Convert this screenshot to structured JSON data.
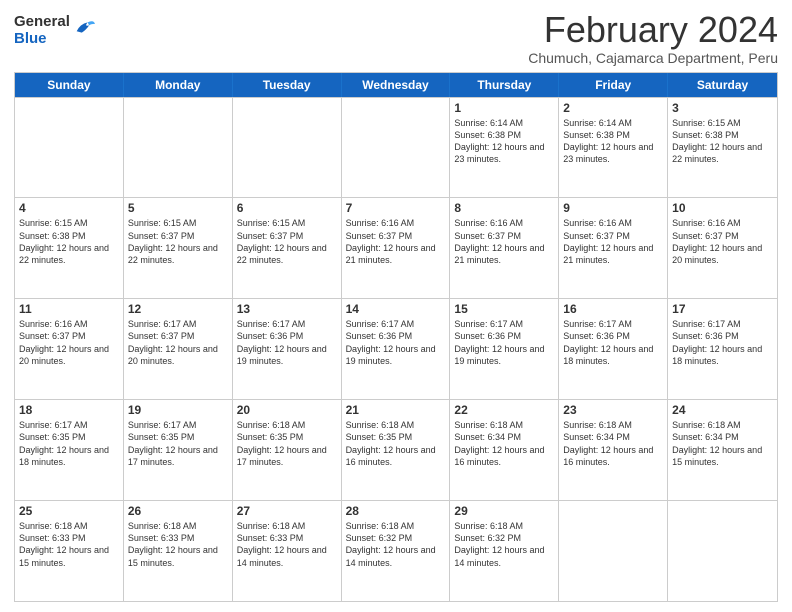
{
  "header": {
    "logo_general": "General",
    "logo_blue": "Blue",
    "cal_title": "February 2024",
    "cal_subtitle": "Chumuch, Cajamarca Department, Peru"
  },
  "days_of_week": [
    "Sunday",
    "Monday",
    "Tuesday",
    "Wednesday",
    "Thursday",
    "Friday",
    "Saturday"
  ],
  "rows": [
    [
      {
        "day": "",
        "info": ""
      },
      {
        "day": "",
        "info": ""
      },
      {
        "day": "",
        "info": ""
      },
      {
        "day": "",
        "info": ""
      },
      {
        "day": "1",
        "info": "Sunrise: 6:14 AM\nSunset: 6:38 PM\nDaylight: 12 hours and 23 minutes."
      },
      {
        "day": "2",
        "info": "Sunrise: 6:14 AM\nSunset: 6:38 PM\nDaylight: 12 hours and 23 minutes."
      },
      {
        "day": "3",
        "info": "Sunrise: 6:15 AM\nSunset: 6:38 PM\nDaylight: 12 hours and 22 minutes."
      }
    ],
    [
      {
        "day": "4",
        "info": "Sunrise: 6:15 AM\nSunset: 6:38 PM\nDaylight: 12 hours and 22 minutes."
      },
      {
        "day": "5",
        "info": "Sunrise: 6:15 AM\nSunset: 6:37 PM\nDaylight: 12 hours and 22 minutes."
      },
      {
        "day": "6",
        "info": "Sunrise: 6:15 AM\nSunset: 6:37 PM\nDaylight: 12 hours and 22 minutes."
      },
      {
        "day": "7",
        "info": "Sunrise: 6:16 AM\nSunset: 6:37 PM\nDaylight: 12 hours and 21 minutes."
      },
      {
        "day": "8",
        "info": "Sunrise: 6:16 AM\nSunset: 6:37 PM\nDaylight: 12 hours and 21 minutes."
      },
      {
        "day": "9",
        "info": "Sunrise: 6:16 AM\nSunset: 6:37 PM\nDaylight: 12 hours and 21 minutes."
      },
      {
        "day": "10",
        "info": "Sunrise: 6:16 AM\nSunset: 6:37 PM\nDaylight: 12 hours and 20 minutes."
      }
    ],
    [
      {
        "day": "11",
        "info": "Sunrise: 6:16 AM\nSunset: 6:37 PM\nDaylight: 12 hours and 20 minutes."
      },
      {
        "day": "12",
        "info": "Sunrise: 6:17 AM\nSunset: 6:37 PM\nDaylight: 12 hours and 20 minutes."
      },
      {
        "day": "13",
        "info": "Sunrise: 6:17 AM\nSunset: 6:36 PM\nDaylight: 12 hours and 19 minutes."
      },
      {
        "day": "14",
        "info": "Sunrise: 6:17 AM\nSunset: 6:36 PM\nDaylight: 12 hours and 19 minutes."
      },
      {
        "day": "15",
        "info": "Sunrise: 6:17 AM\nSunset: 6:36 PM\nDaylight: 12 hours and 19 minutes."
      },
      {
        "day": "16",
        "info": "Sunrise: 6:17 AM\nSunset: 6:36 PM\nDaylight: 12 hours and 18 minutes."
      },
      {
        "day": "17",
        "info": "Sunrise: 6:17 AM\nSunset: 6:36 PM\nDaylight: 12 hours and 18 minutes."
      }
    ],
    [
      {
        "day": "18",
        "info": "Sunrise: 6:17 AM\nSunset: 6:35 PM\nDaylight: 12 hours and 18 minutes."
      },
      {
        "day": "19",
        "info": "Sunrise: 6:17 AM\nSunset: 6:35 PM\nDaylight: 12 hours and 17 minutes."
      },
      {
        "day": "20",
        "info": "Sunrise: 6:18 AM\nSunset: 6:35 PM\nDaylight: 12 hours and 17 minutes."
      },
      {
        "day": "21",
        "info": "Sunrise: 6:18 AM\nSunset: 6:35 PM\nDaylight: 12 hours and 16 minutes."
      },
      {
        "day": "22",
        "info": "Sunrise: 6:18 AM\nSunset: 6:34 PM\nDaylight: 12 hours and 16 minutes."
      },
      {
        "day": "23",
        "info": "Sunrise: 6:18 AM\nSunset: 6:34 PM\nDaylight: 12 hours and 16 minutes."
      },
      {
        "day": "24",
        "info": "Sunrise: 6:18 AM\nSunset: 6:34 PM\nDaylight: 12 hours and 15 minutes."
      }
    ],
    [
      {
        "day": "25",
        "info": "Sunrise: 6:18 AM\nSunset: 6:33 PM\nDaylight: 12 hours and 15 minutes."
      },
      {
        "day": "26",
        "info": "Sunrise: 6:18 AM\nSunset: 6:33 PM\nDaylight: 12 hours and 15 minutes."
      },
      {
        "day": "27",
        "info": "Sunrise: 6:18 AM\nSunset: 6:33 PM\nDaylight: 12 hours and 14 minutes."
      },
      {
        "day": "28",
        "info": "Sunrise: 6:18 AM\nSunset: 6:32 PM\nDaylight: 12 hours and 14 minutes."
      },
      {
        "day": "29",
        "info": "Sunrise: 6:18 AM\nSunset: 6:32 PM\nDaylight: 12 hours and 14 minutes."
      },
      {
        "day": "",
        "info": ""
      },
      {
        "day": "",
        "info": ""
      }
    ]
  ]
}
